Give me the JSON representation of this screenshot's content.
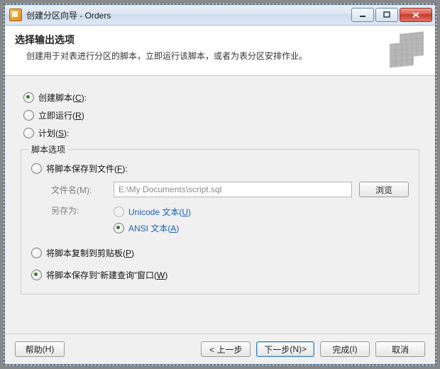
{
  "window": {
    "title": "创建分区向导 - Orders"
  },
  "header": {
    "heading": "选择输出选项",
    "subtext": "创建用于对表进行分区的脚本，立即运行该脚本，或者为表分区安排作业。"
  },
  "options": {
    "create_script": {
      "label": "创建脚本",
      "hotkey": "C",
      "checked": true
    },
    "run_now": {
      "label": "立即运行",
      "hotkey": "R",
      "checked": false
    },
    "schedule": {
      "label": "计划",
      "hotkey": "S",
      "checked": false
    }
  },
  "script_group": {
    "legend": "脚本选项",
    "save_to_file": {
      "label": "将脚本保存到文件",
      "hotkey": "F",
      "checked": false
    },
    "file": {
      "label": "文件名",
      "hotkey": "M",
      "value": "E:\\My Documents\\script.sql",
      "browse_label": "浏览"
    },
    "save_as": {
      "label": "另存为:",
      "unicode": {
        "label": "Unicode 文本",
        "hotkey": "U",
        "checked": false
      },
      "ansi": {
        "label": "ANSI 文本",
        "hotkey": "A",
        "checked": true
      }
    },
    "copy_clipboard": {
      "label": "将脚本复制到剪贴板",
      "hotkey": "P",
      "checked": false
    },
    "save_new_query": {
      "label": "将脚本保存到“新建查询”窗口",
      "hotkey": "W",
      "checked": true
    }
  },
  "footer": {
    "help": {
      "label": "帮助",
      "hotkey": "H"
    },
    "back": {
      "label": "< 上一步"
    },
    "next": {
      "label": "下一步",
      "hotkey": "N",
      "suffix": " >"
    },
    "finish": {
      "label": "完成",
      "hotkey": "I"
    },
    "cancel": {
      "label": "取消"
    }
  }
}
